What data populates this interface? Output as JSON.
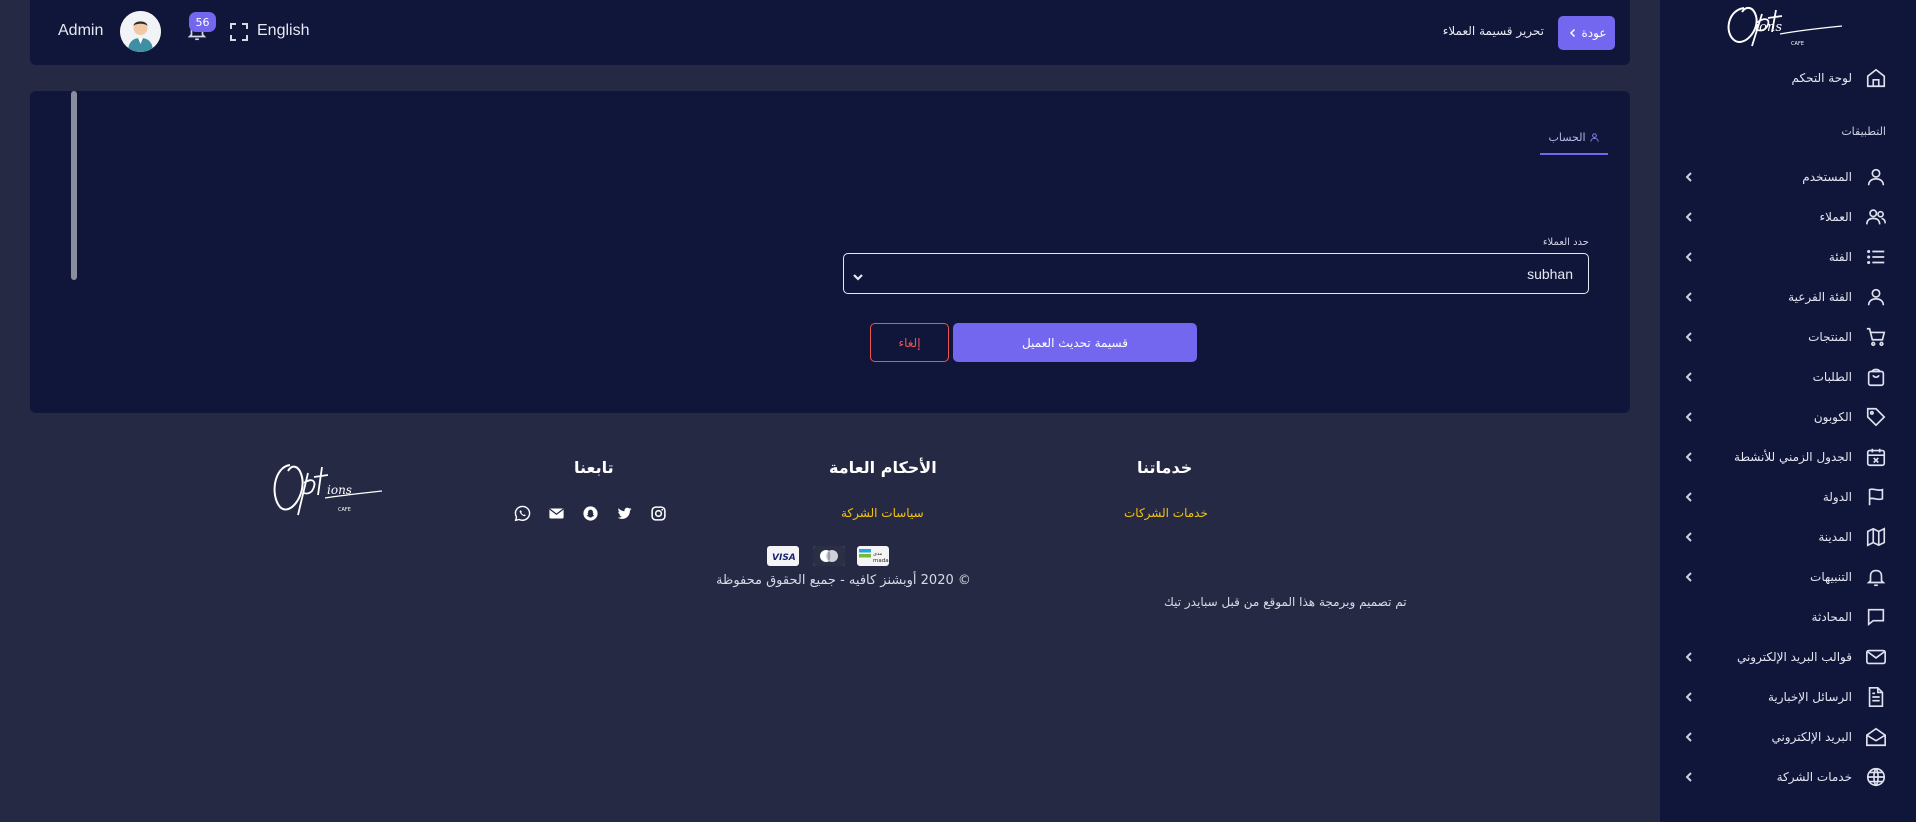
{
  "brand": {
    "logo_text": "Options",
    "logo_sub": "CAFE"
  },
  "sidebar": {
    "dashboard": "لوحة التحكم",
    "section_label": "التطبيقات",
    "items": [
      {
        "label": "المستخدم",
        "icon": "user-icon",
        "has_children": true
      },
      {
        "label": "العملاء",
        "icon": "users-icon",
        "has_children": true
      },
      {
        "label": "الفئة",
        "icon": "list-icon",
        "has_children": true
      },
      {
        "label": "الفئة الفرعية",
        "icon": "user-icon",
        "has_children": true
      },
      {
        "label": "المنتجات",
        "icon": "cart-icon",
        "has_children": true
      },
      {
        "label": "الطلبات",
        "icon": "bag-icon",
        "has_children": true
      },
      {
        "label": "الكوبون",
        "icon": "tag-icon",
        "has_children": true
      },
      {
        "label": "الجدول الزمني للأنشطة",
        "icon": "calendar-x-icon",
        "has_children": true
      },
      {
        "label": "الدولة",
        "icon": "flag-icon",
        "has_children": true
      },
      {
        "label": "المدينة",
        "icon": "map-icon",
        "has_children": true
      },
      {
        "label": "التنبيهات",
        "icon": "bell-icon",
        "has_children": true
      },
      {
        "label": "المحادثة",
        "icon": "chat-icon",
        "has_children": false
      },
      {
        "label": "قوالب البريد الإلكتروني",
        "icon": "mail-icon",
        "has_children": true
      },
      {
        "label": "الرسائل الإخبارية",
        "icon": "file-text-icon",
        "has_children": true
      },
      {
        "label": "البريد الإلكتروني",
        "icon": "mail-open-icon",
        "has_children": true
      },
      {
        "label": "خدمات الشركة",
        "icon": "globe-icon",
        "has_children": true
      }
    ]
  },
  "header": {
    "back_label": "عودة",
    "page_title": "تحرير قسيمة العملاء",
    "admin_name": "Admin",
    "notification_count": "56",
    "language": "English"
  },
  "form": {
    "tab_account": "الحساب",
    "customer_label": "حدد العملاء",
    "customer_value": "subhan",
    "submit_label": "قسيمة تحديث العميل",
    "cancel_label": "إلغاء"
  },
  "footer": {
    "services_heading": "خدماتنا",
    "services_link": "خدمات الشركات",
    "terms_heading": "الأحكام العامة",
    "terms_link": "سياسات الشركة",
    "follow_heading": "تابعنا",
    "social_icons": [
      "instagram-icon",
      "twitter-icon",
      "snapchat-icon",
      "envelope-icon",
      "whatsapp-icon"
    ],
    "payment_labels": {
      "mada": "مدى mada",
      "visa": "VISA"
    },
    "copyright": "© 2020 أوبشنز كافيه - جميع الحقوق محفوظة",
    "made_by": "تم تصميم وبرمجة هذا الموقع من قبل سبايدر تيك"
  },
  "colors": {
    "accent": "#7367f0",
    "danger": "#ea5455",
    "link": "#f1c40f",
    "panel": "#10163a",
    "background": "#252944"
  }
}
